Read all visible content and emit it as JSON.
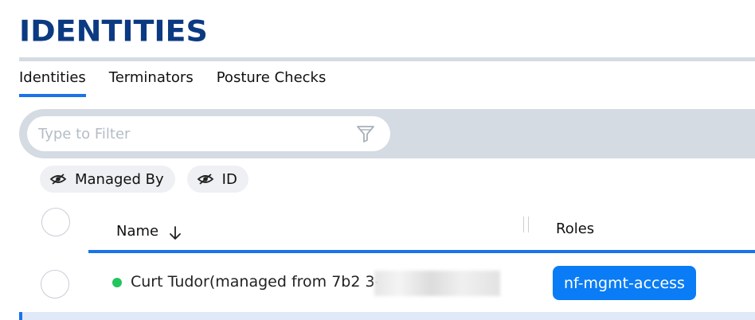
{
  "page": {
    "title": "IDENTITIES"
  },
  "tabs": [
    {
      "label": "Identities",
      "active": true
    },
    {
      "label": "Terminators",
      "active": false
    },
    {
      "label": "Posture Checks",
      "active": false
    }
  ],
  "filter": {
    "placeholder": "Type to Filter",
    "value": "",
    "icon": "filter-funnel-icon"
  },
  "hidden_columns": [
    {
      "label": "Managed By",
      "icon": "eye-slash-icon"
    },
    {
      "label": "ID",
      "icon": "eye-slash-icon"
    }
  ],
  "table": {
    "columns": [
      {
        "label": "Name",
        "sort": "descending",
        "sort_icon": "arrow-down-icon"
      },
      {
        "label": "Roles"
      }
    ],
    "rows": [
      {
        "status": "online",
        "status_color": "#22c55e",
        "name": "Curt Tudor(managed from 7b2                                         3-8",
        "roles": [
          "nf-mgmt-access"
        ]
      }
    ]
  },
  "colors": {
    "title": "#0b3a82",
    "accent": "#1a73e8",
    "badge": "#0a7cf5",
    "filter_bar": "#d5dbe3"
  }
}
